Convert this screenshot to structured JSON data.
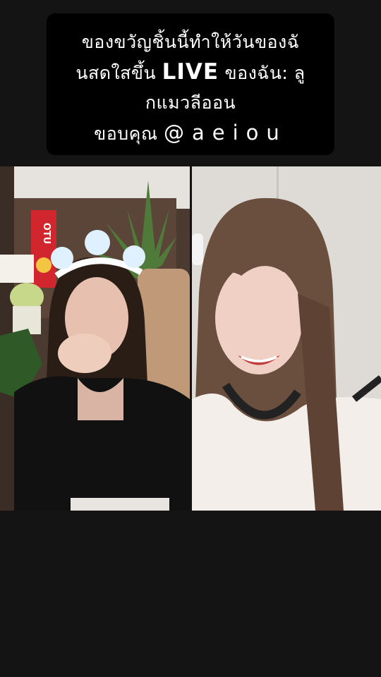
{
  "caption": {
    "line1": "ของขวัญชิ้นนี้ทำให้วันของฉั",
    "line2_prefix": "นสดใสขึ้น ",
    "line2_live": "LIVE",
    "line2_suffix": " ของฉัน: ลู",
    "line3": "กแมวลีออน",
    "line4_prefix": "ขอบคุณ ",
    "line4_handle": "@aeiou"
  },
  "left_video": {
    "banner_text": "OTU"
  },
  "colors": {
    "background": "#141414",
    "caption_bg": "#000000",
    "caption_text": "#ffffff"
  }
}
